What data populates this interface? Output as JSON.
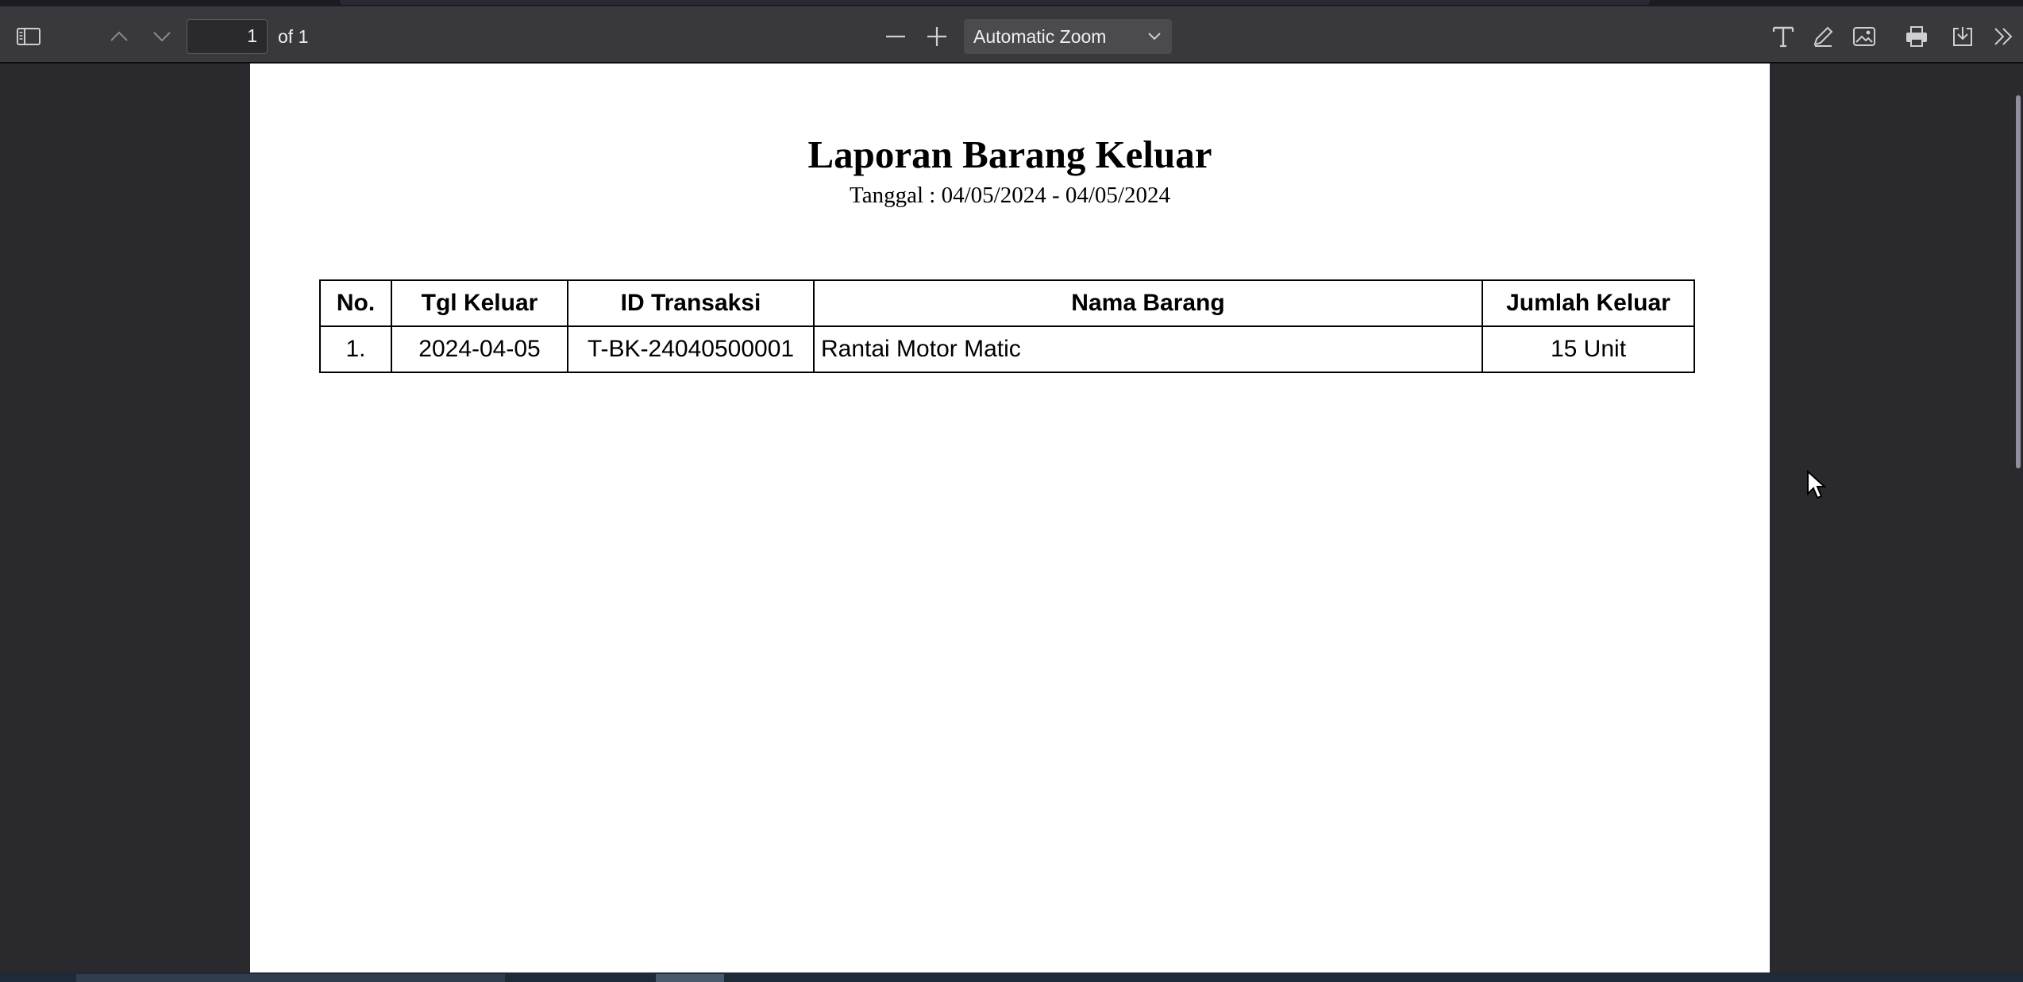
{
  "toolbar": {
    "page_number": "1",
    "page_of": "of 1",
    "zoom_value": "Automatic Zoom",
    "icons": {
      "sidebar": "sidebar-toggle-icon",
      "prev": "chevron-up-icon",
      "next": "chevron-down-icon",
      "zoom_out": "minus-icon",
      "zoom_in": "plus-icon",
      "zoom_dropdown": "chevron-down-icon",
      "text": "text-tool-icon",
      "draw": "pen-icon",
      "image": "image-icon",
      "print": "printer-icon",
      "save": "download-icon",
      "more": "double-chevron-right-icon"
    }
  },
  "document": {
    "title": "Laporan Barang Keluar",
    "subtitle": "Tanggal : 04/05/2024 - 04/05/2024",
    "table": {
      "headers": [
        "No.",
        "Tgl Keluar",
        "ID Transaksi",
        "Nama Barang",
        "Jumlah Keluar"
      ],
      "rows": [
        [
          "1.",
          "2024-04-05",
          "T-BK-24040500001",
          "Rantai Motor Matic",
          "15 Unit"
        ]
      ]
    }
  },
  "colors": {
    "toolbar_bg": "#38383d",
    "viewer_bg": "#2a2a2e",
    "page_bg": "#ffffff",
    "toolbar_text": "#f0f0f0"
  }
}
